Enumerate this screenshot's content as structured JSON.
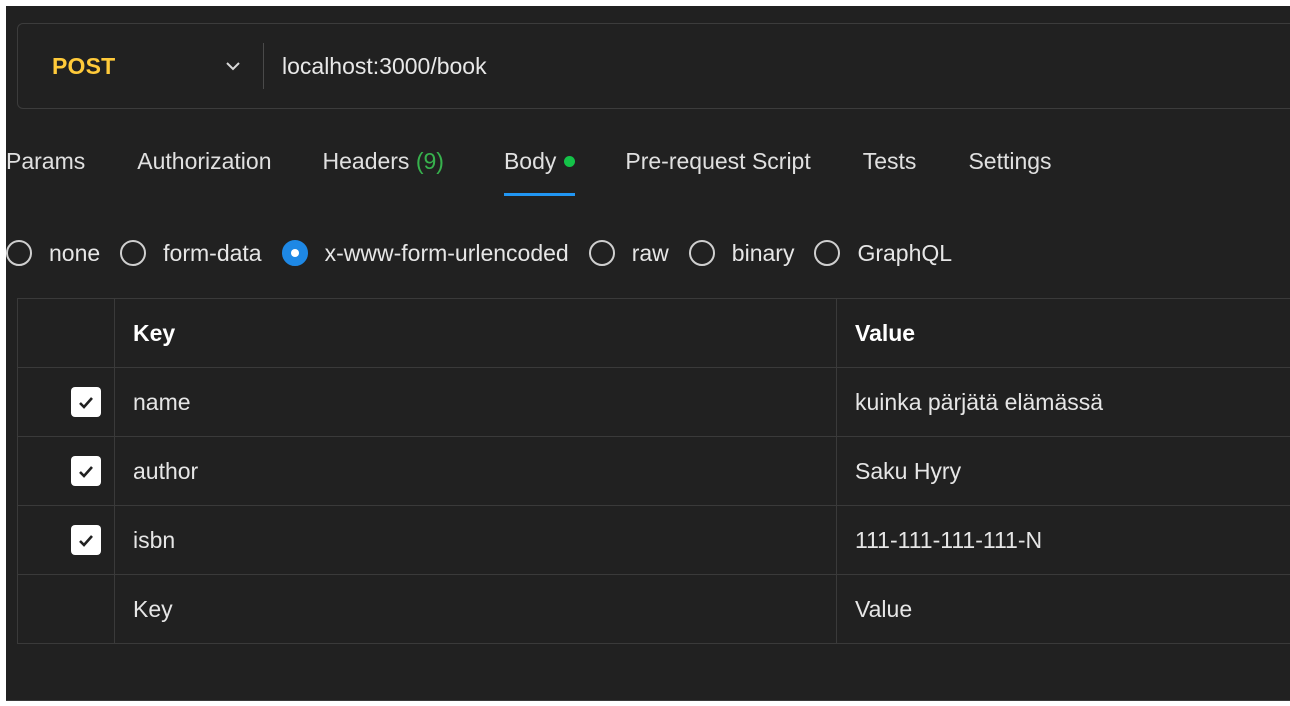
{
  "request": {
    "method": "POST",
    "url": "localhost:3000/book"
  },
  "tabs": [
    {
      "label": "Params"
    },
    {
      "label": "Authorization"
    },
    {
      "label": "Headers",
      "count": "(9)"
    },
    {
      "label": "Body",
      "active": true
    },
    {
      "label": "Pre-request Script"
    },
    {
      "label": "Tests"
    },
    {
      "label": "Settings"
    }
  ],
  "body_types": [
    {
      "label": "none",
      "selected": false
    },
    {
      "label": "form-data",
      "selected": false
    },
    {
      "label": "x-www-form-urlencoded",
      "selected": true
    },
    {
      "label": "raw",
      "selected": false
    },
    {
      "label": "binary",
      "selected": false
    },
    {
      "label": "GraphQL",
      "selected": false
    }
  ],
  "table": {
    "headers": {
      "key": "Key",
      "value": "Value"
    },
    "rows": [
      {
        "checked": true,
        "key": "name",
        "value": "kuinka pärjätä elämässä"
      },
      {
        "checked": true,
        "key": "author",
        "value": "Saku Hyry"
      },
      {
        "checked": true,
        "key": "isbn",
        "value": "111-111-111-111-N"
      }
    ],
    "new_row": {
      "key_placeholder": "Key",
      "value_placeholder": "Value"
    }
  },
  "colors": {
    "background": "#212121",
    "method": "#ffca3a",
    "accent": "#2196f3",
    "count": "#37b24d",
    "dot": "#14c248"
  }
}
